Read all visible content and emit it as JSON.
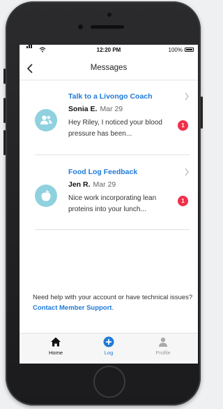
{
  "status_bar": {
    "time": "12:20 PM",
    "battery": "100%"
  },
  "nav": {
    "title": "Messages"
  },
  "messages": [
    {
      "subject": "Talk to a Livongo Coach",
      "sender": "Sonia E.",
      "date": "Mar 29",
      "preview": "Hey Riley, I noticed your blood pressure has been...",
      "unread": "1",
      "avatar_icon": "people-icon"
    },
    {
      "subject": "Food Log Feedback",
      "sender": "Jen R.",
      "date": "Mar 29",
      "preview": "Nice work incorporating lean proteins into your lunch...",
      "unread": "1",
      "avatar_icon": "apple-icon"
    }
  ],
  "help": {
    "text": "Need help with your account or have technical issues? ",
    "link": "Contact Member Support",
    "suffix": "."
  },
  "tabs": [
    {
      "label": "Home",
      "icon": "home-icon"
    },
    {
      "label": "Log",
      "icon": "plus-circle-icon"
    },
    {
      "label": "Profile",
      "icon": "person-icon"
    }
  ],
  "colors": {
    "accent": "#1f7ad8",
    "badge": "#f0304a",
    "avatar": "#8fd1df"
  }
}
